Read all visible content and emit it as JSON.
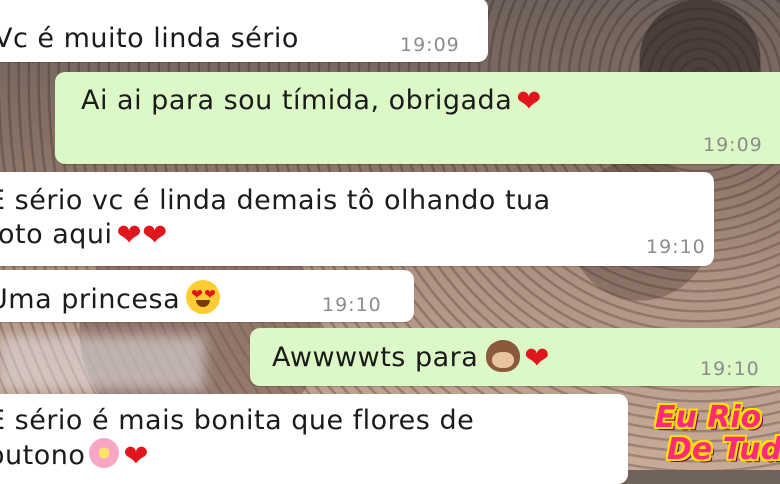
{
  "messages": [
    {
      "text": "Vc é muito linda sério",
      "time": "19:09",
      "emojis": []
    },
    {
      "text": "Ai ai para sou tímida, obrigada",
      "time": "19:09",
      "emojis": [
        "red-heart"
      ]
    },
    {
      "line1": "E sério vc é linda demais tô olhando tua",
      "line2": "foto aqui",
      "time": "19:10",
      "emojis": [
        "red-heart",
        "red-heart"
      ]
    },
    {
      "text": "Uma princesa",
      "time": "19:10",
      "emojis": [
        "heart-eyes-face"
      ]
    },
    {
      "text": "Awwwwts para",
      "time": "19:10",
      "emojis": [
        "see-no-evil-monkey",
        "red-heart"
      ]
    },
    {
      "line1": "E sério é mais bonita que flores de",
      "line2": "outono",
      "emojis": [
        "cherry-blossom",
        "red-heart"
      ]
    }
  ],
  "watermark": {
    "line1": "Eu Rio",
    "line2": "De Tudo"
  },
  "colors": {
    "incoming": "#ffffff",
    "outgoing": "#dcf8c6",
    "heart": "#e0161c",
    "time": "#8c8c8c"
  }
}
